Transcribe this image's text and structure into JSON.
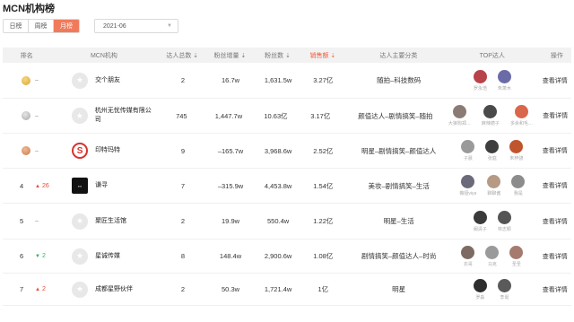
{
  "title": "MCN机构榜",
  "tabs": [
    {
      "label": "日榜",
      "active": false
    },
    {
      "label": "周榜",
      "active": false
    },
    {
      "label": "月榜",
      "active": true
    }
  ],
  "date": "2021-06",
  "columns": {
    "rank": "排名",
    "mcn": "MCN机构",
    "talents": "达人总数",
    "growth": "粉丝增量",
    "fans": "粉丝数",
    "sales": "销售额",
    "category": "达人主要分类",
    "top": "TOP达人",
    "op": "操作"
  },
  "rows": [
    {
      "rank": "",
      "medal": "gold",
      "change": "–",
      "change_dir": "none",
      "logo": "star",
      "name": "交个朋友",
      "talents": "2",
      "growth": "16.7w",
      "fans": "1,631.5w",
      "sales": "3.27亿",
      "category": "随拍–科技数码",
      "top": [
        {
          "name": "罗永浩",
          "color": "#b8424a"
        },
        {
          "name": "朱萧木",
          "color": "#6b6ba8"
        }
      ],
      "op": "查看详情"
    },
    {
      "rank": "",
      "medal": "silver",
      "change": "–",
      "change_dir": "none",
      "logo": "star",
      "name": "杭州无忧传媒有限公司",
      "talents": "745",
      "growth": "1,447.7w",
      "fans": "10.63亿",
      "sales": "3.17亿",
      "category": "颜值达人–剧情搞笑–随拍",
      "top": [
        {
          "name": "大狼狗郑…",
          "color": "#8a7b74"
        },
        {
          "name": "麻辣德子",
          "color": "#4a4a4a"
        },
        {
          "name": "多余和毛…",
          "color": "#d9674b"
        }
      ],
      "op": "查看详情"
    },
    {
      "rank": "",
      "medal": "bronze",
      "change": "–",
      "change_dir": "none",
      "logo": "red",
      "name": "印特玛特",
      "talents": "9",
      "growth": "–165.7w",
      "fans": "3,968.6w",
      "sales": "2.52亿",
      "category": "明星–剧情搞笑–颜值达人",
      "top": [
        {
          "name": "子晨",
          "color": "#9a9a9a"
        },
        {
          "name": "张庭",
          "color": "#3e3e3e"
        },
        {
          "name": "朱梓骁",
          "color": "#c0542d"
        }
      ],
      "op": "查看详情"
    },
    {
      "rank": "4",
      "medal": "",
      "change": "26",
      "change_dir": "up",
      "logo": "sq",
      "name": "谦寻",
      "talents": "7",
      "growth": "–315.9w",
      "fans": "4,453.8w",
      "sales": "1.54亿",
      "category": "美妆–剧情搞笑–生活",
      "top": [
        {
          "name": "薇娅viya",
          "color": "#6a6a7a"
        },
        {
          "name": "聊聊酱",
          "color": "#b69a84"
        },
        {
          "name": "我是",
          "color": "#8c8c8c"
        }
      ],
      "op": "查看详情"
    },
    {
      "rank": "5",
      "medal": "",
      "change": "–",
      "change_dir": "none",
      "logo": "star",
      "name": "聚匠生活馆",
      "talents": "2",
      "growth": "19.9w",
      "fans": "550.4w",
      "sales": "1.22亿",
      "category": "明星–生活",
      "top": [
        {
          "name": "阚清子",
          "color": "#3a3a3a"
        },
        {
          "name": "林志颖",
          "color": "#555"
        }
      ],
      "op": "查看详情"
    },
    {
      "rank": "6",
      "medal": "",
      "change": "2",
      "change_dir": "down",
      "logo": "star",
      "name": "星诚传媒",
      "talents": "8",
      "growth": "148.4w",
      "fans": "2,900.6w",
      "sales": "1.08亿",
      "category": "剧情搞笑–颜值达人–时尚",
      "top": [
        {
          "name": "衣哥",
          "color": "#7d6b63"
        },
        {
          "name": "马克",
          "color": "#9a9a9a"
        },
        {
          "name": "圣圣",
          "color": "#a57b6f"
        }
      ],
      "op": "查看详情"
    },
    {
      "rank": "7",
      "medal": "",
      "change": "2",
      "change_dir": "up",
      "logo": "star",
      "name": "成都星野伙伴",
      "talents": "2",
      "growth": "50.3w",
      "fans": "1,721.4w",
      "sales": "1亿",
      "category": "明星",
      "top": [
        {
          "name": "罗淼",
          "color": "#2e2e2e"
        },
        {
          "name": "李诞",
          "color": "#5a5a5a"
        }
      ],
      "op": "查看详情"
    }
  ]
}
